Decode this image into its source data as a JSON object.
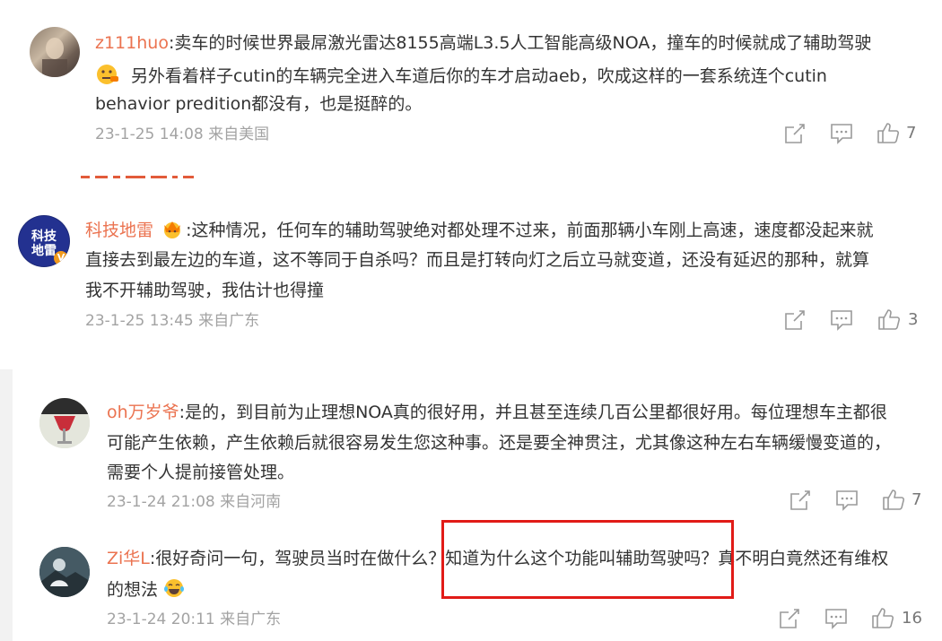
{
  "comments": [
    {
      "username": "z111huo",
      "text_lines": [
        "卖车的时候世界最屌激光雷达8155高端L3.5人工智能高级NOA，撞车的时候就成了辅助驾驶",
        "另外看着样子cutin的车辆完全进入车道后你的车才启动aeb，吹成这样的一套系统连个cutin",
        "behavior predition都没有，也是挺醉的。"
      ],
      "time": "23-1-25 14:08",
      "location": "来自美国",
      "likes": "7"
    },
    {
      "username": "科技地雷",
      "text_lines": [
        ":这种情况，任何车的辅助驾驶绝对都处理不过来，前面那辆小车刚上高速，速度都没起来就",
        "直接去到最左边的车道，这不等同于自杀吗？而且是打转向灯之后立马就变道，还没有延迟的那种，就算",
        "我不开辅助驾驶，我估计也得撞"
      ],
      "avatar_text": "科技地雷",
      "verified_badge": "V",
      "time": "23-1-25 13:45",
      "location": "来自广东",
      "likes": "3"
    },
    {
      "username": "oh万岁爷",
      "text_lines": [
        ":是的，到目前为止理想NOA真的很好用，并且甚至连续几百公里都很好用。每位理想车主都很",
        "可能产生依赖，产生依赖后就很容易发生您这种事。还是要全神贯注，尤其像这种左右车辆缓慢变道的，",
        "需要个人提前接管处理。"
      ],
      "time": "23-1-24 21:08",
      "location": "来自河南",
      "likes": "7"
    },
    {
      "username": "Zi华L",
      "text_lines": [
        ":很好奇问一句，驾驶员当时在做什么？知道为什么这个功能叫辅助驾驶吗？真不明白竟然还有维权",
        "的想法"
      ],
      "time": "23-1-24 20:11",
      "location": "来自广东",
      "likes": "16"
    }
  ],
  "colors": {
    "username": "#eb7350",
    "meta": "#a3a3a3",
    "highlight_box": "#e11b17"
  },
  "icons": [
    "share-icon",
    "comment-icon",
    "thumbs-up-icon",
    "thinking-emoji",
    "crown-emoji",
    "laugh-cry-emoji"
  ]
}
